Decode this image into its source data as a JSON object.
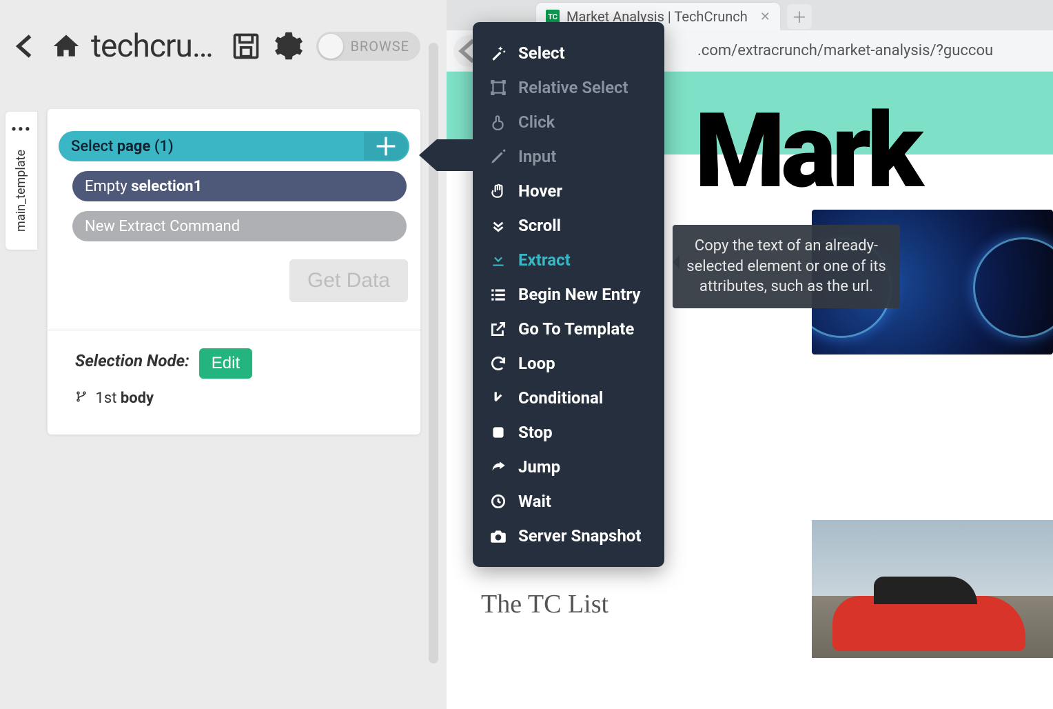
{
  "header": {
    "title": "techcru…",
    "toggle_label": "BROWSE"
  },
  "tab_rail": {
    "label": "main_template"
  },
  "commands": {
    "select_page_prefix": "Select ",
    "select_page_bold": "page",
    "select_page_count": " (1)",
    "empty_prefix": "Empty ",
    "empty_name": "selection1",
    "new_extract": "New Extract Command",
    "get_data": "Get Data"
  },
  "selection": {
    "label": "Selection Node:",
    "edit": "Edit",
    "path_ord": "1st ",
    "path_tag": "body"
  },
  "browser": {
    "tab_title": "Market Analysis | TechCrunch",
    "favicon_text": "TC",
    "url_fragment": ".com/extracrunch/market-analysis/?guccou"
  },
  "page": {
    "headline": "Mark",
    "tc_list": "The TC List"
  },
  "ctx": {
    "items": [
      {
        "label": "Select",
        "state": "normal",
        "icon": "wand"
      },
      {
        "label": "Relative Select",
        "state": "dim",
        "icon": "relselect"
      },
      {
        "label": "Click",
        "state": "dim",
        "icon": "pointer"
      },
      {
        "label": "Input",
        "state": "dim",
        "icon": "pencil"
      },
      {
        "label": "Hover",
        "state": "normal",
        "icon": "hand"
      },
      {
        "label": "Scroll",
        "state": "normal",
        "icon": "chevrons"
      },
      {
        "label": "Extract",
        "state": "active",
        "icon": "download"
      },
      {
        "label": "Begin New Entry",
        "state": "normal",
        "icon": "list"
      },
      {
        "label": "Go To Template",
        "state": "normal",
        "icon": "external"
      },
      {
        "label": "Loop",
        "state": "normal",
        "icon": "refresh"
      },
      {
        "label": "Conditional",
        "state": "normal",
        "icon": "turndown"
      },
      {
        "label": "Stop",
        "state": "normal",
        "icon": "stop"
      },
      {
        "label": "Jump",
        "state": "normal",
        "icon": "share"
      },
      {
        "label": "Wait",
        "state": "normal",
        "icon": "clock"
      },
      {
        "label": "Server Snapshot",
        "state": "normal",
        "icon": "camera"
      }
    ]
  },
  "tooltip": {
    "text": "Copy the text of an already-selected element or one of its attributes, such as the url."
  }
}
